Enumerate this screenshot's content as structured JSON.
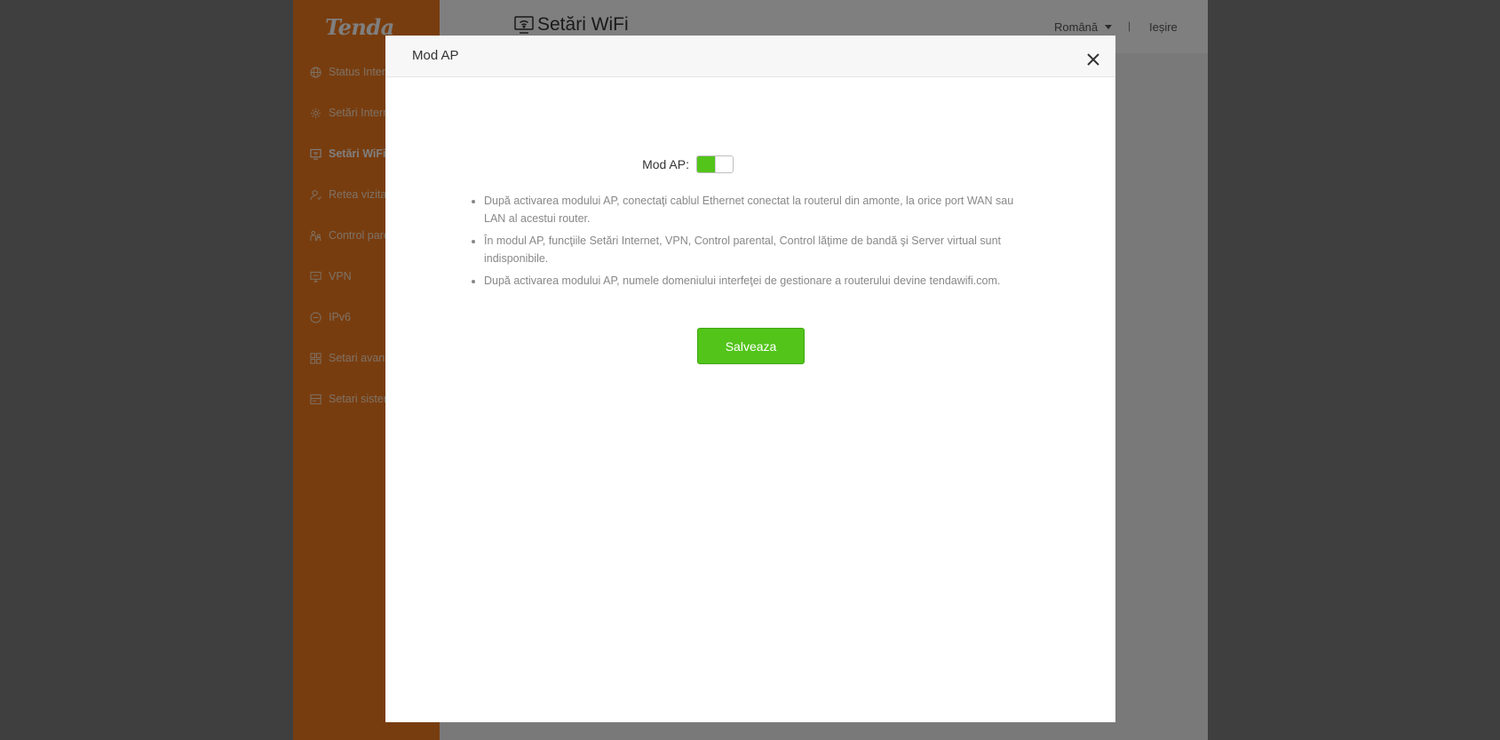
{
  "brand": {
    "logo_text": "Tenda"
  },
  "sidebar": {
    "items": [
      {
        "label": "Status Internet",
        "icon": "globe-icon",
        "active": false
      },
      {
        "label": "Setări Internet",
        "icon": "gear-icon",
        "active": false
      },
      {
        "label": "Setări WiFi",
        "icon": "wifi-screen-icon",
        "active": true
      },
      {
        "label": "Retea vizitatori",
        "icon": "guest-user-icon",
        "active": false
      },
      {
        "label": "Control parental",
        "icon": "family-icon",
        "active": false
      },
      {
        "label": "VPN",
        "icon": "monitor-icon",
        "active": false
      },
      {
        "label": "IPv6",
        "icon": "ipv6-icon",
        "active": false
      },
      {
        "label": "Setari avansate",
        "icon": "grid-icon",
        "active": false
      },
      {
        "label": "Setari sistem",
        "icon": "system-icon",
        "active": false
      }
    ]
  },
  "header": {
    "title": "Setări WiFi",
    "title_icon": "wifi-screen-icon",
    "language": "Română",
    "separator": "|",
    "logout": "Ieșire"
  },
  "modal": {
    "title": "Mod AP",
    "close_icon": "close-icon",
    "toggle_label": "Mod AP:",
    "toggle_on": true,
    "notes": [
      "După activarea modului AP, conectaţi cablul Ethernet conectat la routerul din amonte, la orice port WAN sau LAN al acestui router.",
      "În modul AP, funcţiile Setări Internet, VPN, Control parental, Control lăţime de bandă şi Server virtual sunt indisponibile.",
      "După activarea modului AP, numele domeniului interfeţei de gestionare a routerului devine tendawifi.com."
    ],
    "save_label": "Salveaza"
  },
  "colors": {
    "accent": "#52c41a",
    "sidebar": "#f07a1f",
    "overlay": "rgba(0,0,0,0.5)"
  }
}
